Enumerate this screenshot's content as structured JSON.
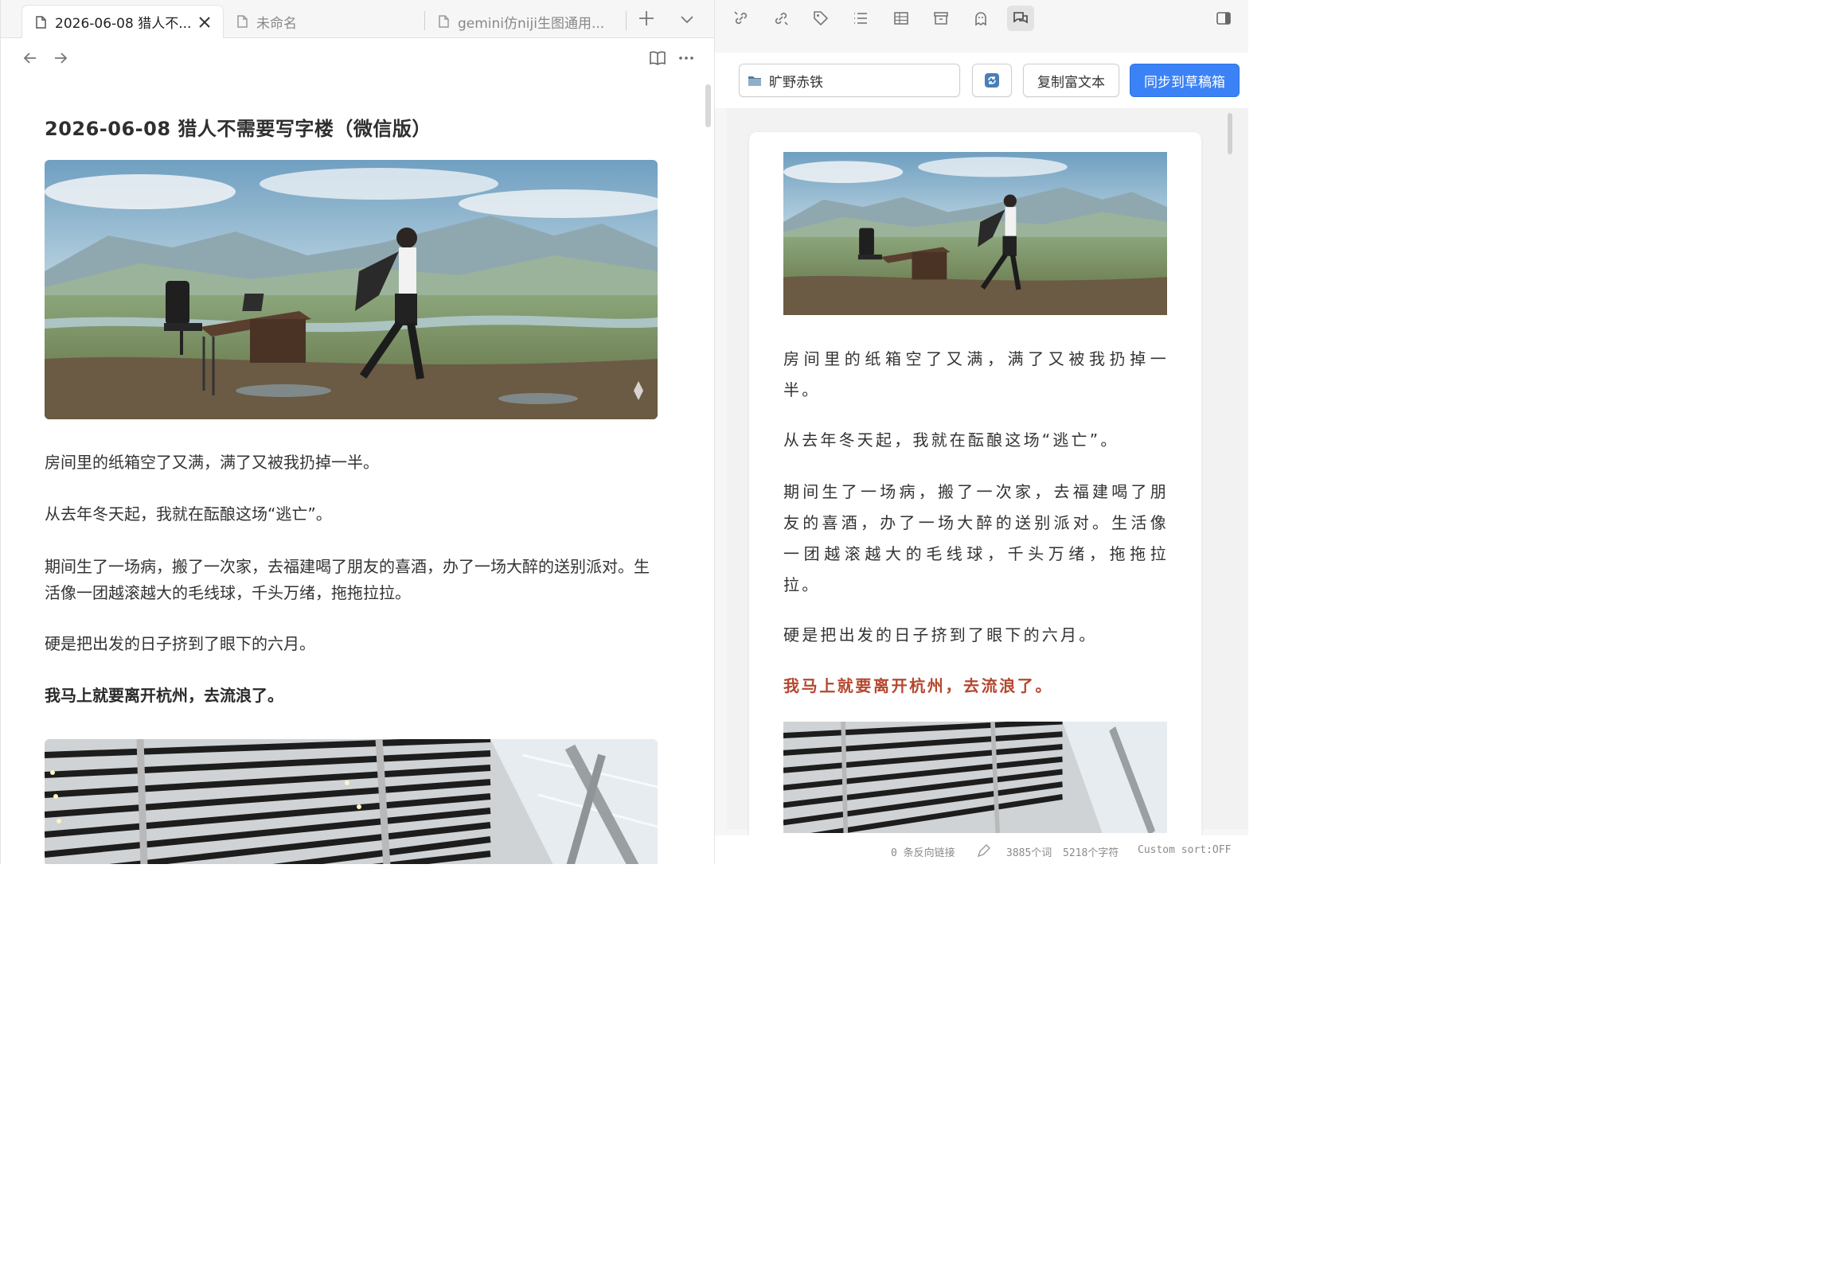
{
  "tabs": [
    {
      "label": "2026-06-08 猎人不...",
      "active": true
    },
    {
      "label": "未命名",
      "active": false
    },
    {
      "label": "gemini仿niji生图通用...",
      "active": false
    }
  ],
  "editor": {
    "title": "2026-06-08 猎人不需要写字楼（微信版）",
    "paragraphs": [
      "房间里的纸箱空了又满，满了又被我扔掉一半。",
      "从去年冬天起，我就在酝酿这场“逃亡”。",
      "期间生了一场病，搬了一次家，去福建喝了朋友的喜酒，办了一场大醉的送别派对。生活像一团越滚越大的毛线球，千头万绪，拖拖拉拉。",
      "硬是把出发的日子挤到了眼下的六月。",
      "我马上就要离开杭州，去流浪了。"
    ]
  },
  "preview": {
    "folder": "旷野赤铁",
    "copy_label": "复制富文本",
    "sync_label": "同步到草稿箱",
    "paragraphs": [
      "房间里的纸箱空了又满，满了又被我扔掉一半。",
      "从去年冬天起，我就在酝酿这场“逃亡”。",
      "期间生了一场病，搬了一次家，去福建喝了朋友的喜酒，办了一场大醉的送别派对。生活像一团越滚越大的毛线球，千头万绪，拖拖拉拉。",
      "硬是把出发的日子挤到了眼下的六月。",
      "我马上就要离开杭州，去流浪了。"
    ]
  },
  "status": {
    "backlinks": "0 条反向链接",
    "words": "3885个词",
    "chars": "5218个字符",
    "sort": "Custom sort:OFF"
  },
  "icons": [
    "file-icon",
    "close-icon",
    "plus-icon",
    "chevron-down-icon",
    "arrow-left-icon",
    "arrow-right-icon",
    "book-icon",
    "more-icon",
    "link-in-icon",
    "link-out-icon",
    "tag-icon",
    "list-icon",
    "table-icon",
    "archive-icon",
    "ghost-icon",
    "chat-icon",
    "sidebar-icon",
    "folder-icon",
    "refresh-icon",
    "pencil-icon"
  ],
  "colors": {
    "accent": "#3b82f6",
    "highlight_red": "#b5472f"
  }
}
